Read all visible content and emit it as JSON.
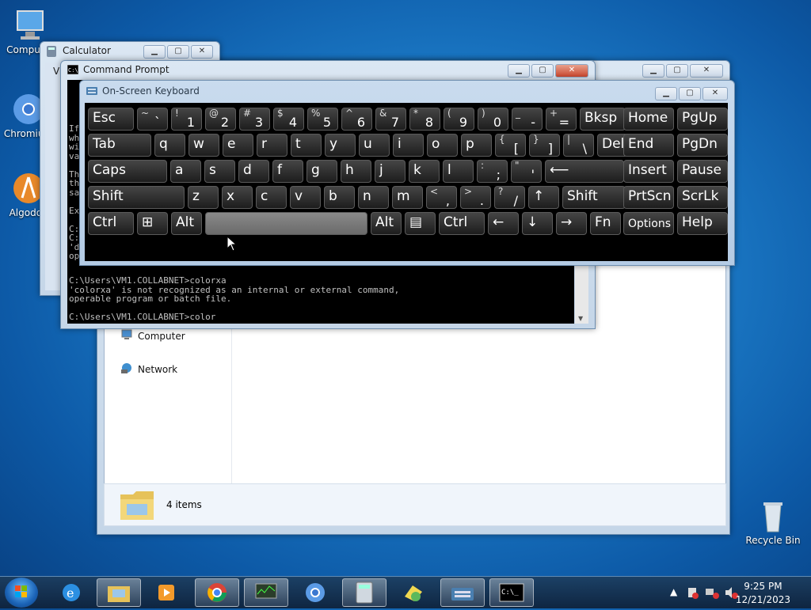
{
  "desktop": {
    "icons": [
      {
        "label": "Computer"
      },
      {
        "label": "Chromium"
      },
      {
        "label": "Algodoo"
      },
      {
        "label": "Recycle Bin"
      }
    ]
  },
  "calculator": {
    "title": "Calculator",
    "menu": "Vi"
  },
  "explorer": {
    "nav": {
      "computer": "Computer",
      "network": "Network"
    },
    "status": "4 items"
  },
  "cmd": {
    "title": "Command Prompt",
    "partial_lines": [
      "If",
      "wh",
      "wi",
      "va",
      "",
      "Th",
      "th",
      "sa",
      "",
      "Ex",
      "",
      "C:",
      "C:",
      "'d",
      "op"
    ],
    "lines": [
      "C:\\Users\\VM1.COLLABNET>colorxa",
      "'colorxa' is not recognized as an internal or external command,",
      "operable program or batch file.",
      "",
      "C:\\Users\\VM1.COLLABNET>color"
    ]
  },
  "osk": {
    "title": "On-Screen Keyboard",
    "rows": [
      [
        {
          "main": "Esc"
        },
        {
          "shift": "~",
          "main": "`"
        },
        {
          "shift": "!",
          "main": "1"
        },
        {
          "shift": "@",
          "main": "2"
        },
        {
          "shift": "#",
          "main": "3"
        },
        {
          "shift": "$",
          "main": "4"
        },
        {
          "shift": "%",
          "main": "5"
        },
        {
          "shift": "^",
          "main": "6"
        },
        {
          "shift": "&",
          "main": "7"
        },
        {
          "shift": "*",
          "main": "8"
        },
        {
          "shift": "(",
          "main": "9"
        },
        {
          "shift": ")",
          "main": "0"
        },
        {
          "shift": "_",
          "main": "-"
        },
        {
          "shift": "+",
          "main": "="
        },
        {
          "main": "Bksp"
        },
        {
          "main": "Home"
        },
        {
          "main": "PgUp"
        }
      ],
      [
        {
          "main": "Tab"
        },
        {
          "main": "q"
        },
        {
          "main": "w"
        },
        {
          "main": "e"
        },
        {
          "main": "r"
        },
        {
          "main": "t"
        },
        {
          "main": "y"
        },
        {
          "main": "u"
        },
        {
          "main": "i"
        },
        {
          "main": "o"
        },
        {
          "main": "p"
        },
        {
          "shift": "{",
          "main": "["
        },
        {
          "shift": "}",
          "main": "]"
        },
        {
          "shift": "|",
          "main": "\\"
        },
        {
          "main": "Del"
        },
        {
          "main": "End"
        },
        {
          "main": "PgDn"
        }
      ],
      [
        {
          "main": "Caps"
        },
        {
          "main": "a"
        },
        {
          "main": "s"
        },
        {
          "main": "d"
        },
        {
          "main": "f"
        },
        {
          "main": "g"
        },
        {
          "main": "h"
        },
        {
          "main": "j"
        },
        {
          "main": "k"
        },
        {
          "main": "l"
        },
        {
          "shift": ":",
          "main": ";"
        },
        {
          "shift": "\"",
          "main": "'"
        },
        {
          "main": "⟵"
        },
        {
          "main": "Insert"
        },
        {
          "main": "Pause"
        }
      ],
      [
        {
          "main": "Shift"
        },
        {
          "main": "z"
        },
        {
          "main": "x"
        },
        {
          "main": "c"
        },
        {
          "main": "v"
        },
        {
          "main": "b"
        },
        {
          "main": "n"
        },
        {
          "main": "m"
        },
        {
          "shift": "<",
          "main": ","
        },
        {
          "shift": ">",
          "main": "."
        },
        {
          "shift": "?",
          "main": "/"
        },
        {
          "main": "↑"
        },
        {
          "main": "Shift"
        },
        {
          "main": "PrtScn"
        },
        {
          "main": "ScrLk"
        }
      ],
      [
        {
          "main": "Ctrl"
        },
        {
          "main": "⊞"
        },
        {
          "main": "Alt"
        },
        {
          "main": ""
        },
        {
          "main": "Alt"
        },
        {
          "main": "▤"
        },
        {
          "main": "Ctrl"
        },
        {
          "main": "←"
        },
        {
          "main": "↓"
        },
        {
          "main": "→"
        },
        {
          "main": "Fn"
        },
        {
          "main": "Options"
        },
        {
          "main": "Help"
        }
      ]
    ]
  },
  "taskbar": {
    "buttons": [
      "internet-explorer",
      "windows-explorer",
      "media-player",
      "chrome",
      "task-manager",
      "chromium",
      "calculator",
      "sync-center",
      "on-screen-keyboard",
      "command-prompt"
    ],
    "time": "9:25 PM",
    "date": "12/21/2023"
  }
}
